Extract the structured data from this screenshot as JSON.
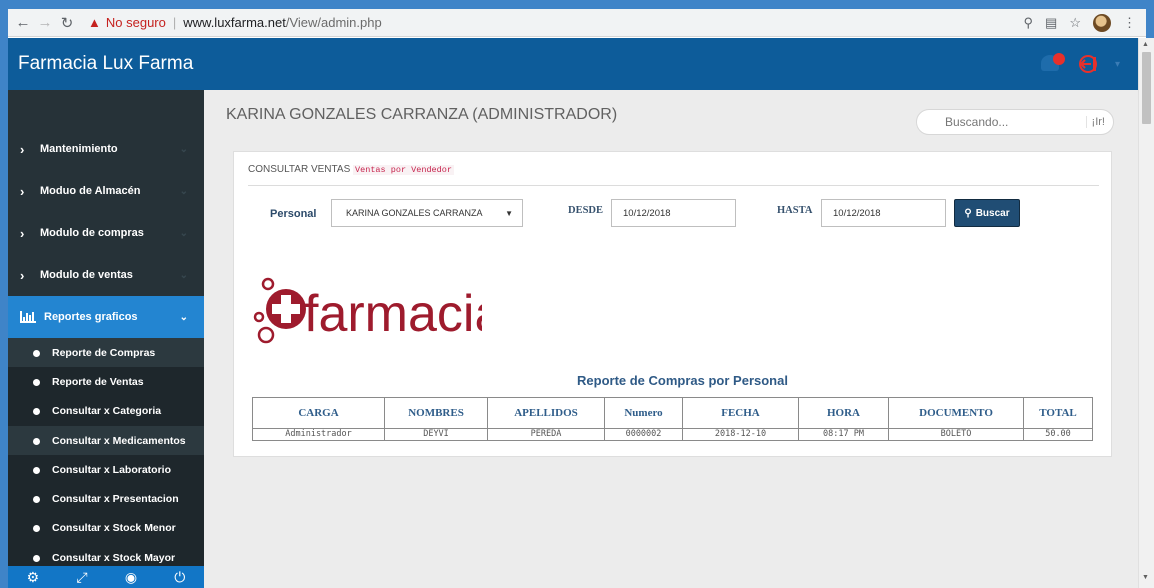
{
  "browser": {
    "security_label": "No seguro",
    "url_host": "www.luxfarma.net",
    "url_path": "/View/admin.php"
  },
  "header": {
    "brand": "Farmacia Lux Farma",
    "brand_color": "#0d5c9a"
  },
  "sidebar": {
    "items": [
      {
        "label": "Mantenimiento"
      },
      {
        "label": "Moduo de Almacén"
      },
      {
        "label": "Modulo de compras"
      },
      {
        "label": "Modulo de ventas"
      },
      {
        "label": "Reportes graficos"
      }
    ],
    "subitems": [
      "Reporte de Compras",
      "Reporte de Ventas",
      "Consultar x Categoria",
      "Consultar x Medicamentos",
      "Consultar x Laboratorio",
      "Consultar x Presentacion",
      "Consultar x Stock Menor",
      "Consultar x Stock Mayor"
    ]
  },
  "main": {
    "user_title": "KARINA GONZALES CARRANZA (ADMINISTRADOR)",
    "search": {
      "placeholder": "Buscando...",
      "go_label": "¡Ir!"
    },
    "card": {
      "heading": "CONSULTAR VENTAS",
      "heading_code": "Ventas por Vendedor"
    },
    "filters": {
      "personal_label": "Personal",
      "personal_value": "KARINA GONZALES CARRANZA",
      "desde_label": "DESDE",
      "desde_value": "10/12/2018",
      "hasta_label": "HASTA",
      "hasta_value": "10/12/2018",
      "buscar_label": "Buscar"
    },
    "logo_text": "farmacia",
    "report_title": "Reporte de Compras por Personal",
    "table": {
      "headers": [
        "CARGA",
        "NOMBRES",
        "APELLIDOS",
        "Numero",
        "FECHA",
        "HORA",
        "DOCUMENTO",
        "TOTAL"
      ],
      "rows": [
        [
          "Administrador",
          "DEYVI",
          "PEREDA",
          "0000002",
          "2018-12-10",
          "08:17 PM",
          "BOLETO",
          "50.00"
        ]
      ]
    }
  }
}
